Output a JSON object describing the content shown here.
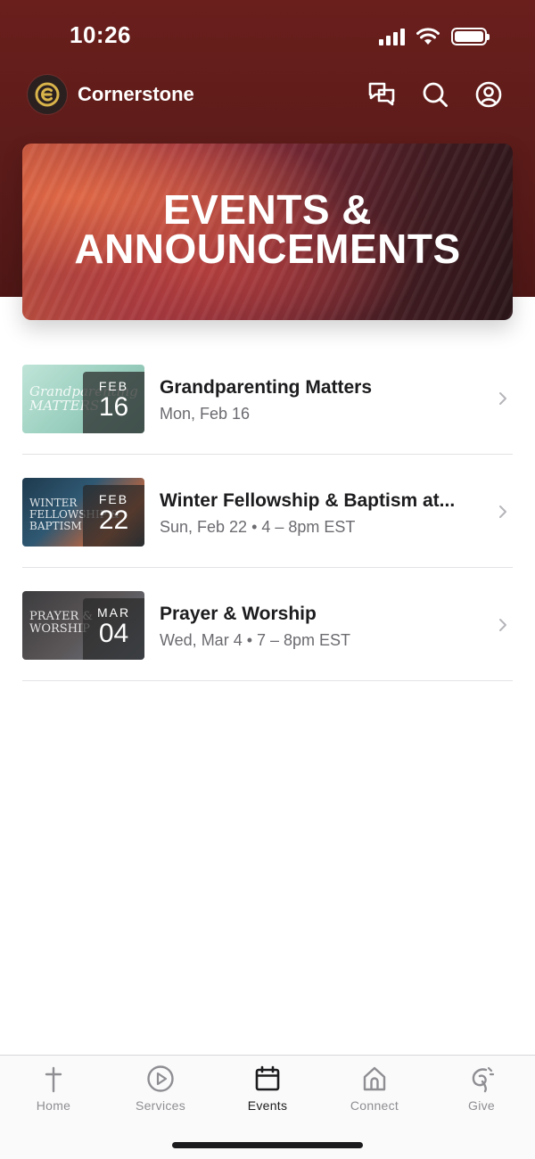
{
  "status_bar": {
    "time": "10:26"
  },
  "header": {
    "app_name": "Cornerstone",
    "accent_color": "#d9b44a"
  },
  "banner": {
    "line1": "EVENTS &",
    "line2": "ANNOUNCEMENTS"
  },
  "events": [
    {
      "title": "Grandparenting Matters",
      "subtitle": "Mon, Feb 16",
      "month": "FEB",
      "day": "16",
      "art_text": "Grandparenting MATTERS"
    },
    {
      "title": "Winter Fellowship & Baptism at...",
      "subtitle": "Sun, Feb 22 • 4 – 8pm EST",
      "month": "FEB",
      "day": "22",
      "art_text": "WINTER FELLOWSHIP & BAPTISM"
    },
    {
      "title": "Prayer & Worship",
      "subtitle": "Wed, Mar 4 • 7 – 8pm EST",
      "month": "MAR",
      "day": "04",
      "art_text": "PRAYER & WORSHIP"
    }
  ],
  "tabs": [
    {
      "label": "Home",
      "icon": "cross-icon"
    },
    {
      "label": "Services",
      "icon": "play-icon"
    },
    {
      "label": "Events",
      "icon": "calendar-icon"
    },
    {
      "label": "Connect",
      "icon": "house-icon"
    },
    {
      "label": "Give",
      "icon": "give-icon"
    }
  ],
  "active_tab": "Events"
}
